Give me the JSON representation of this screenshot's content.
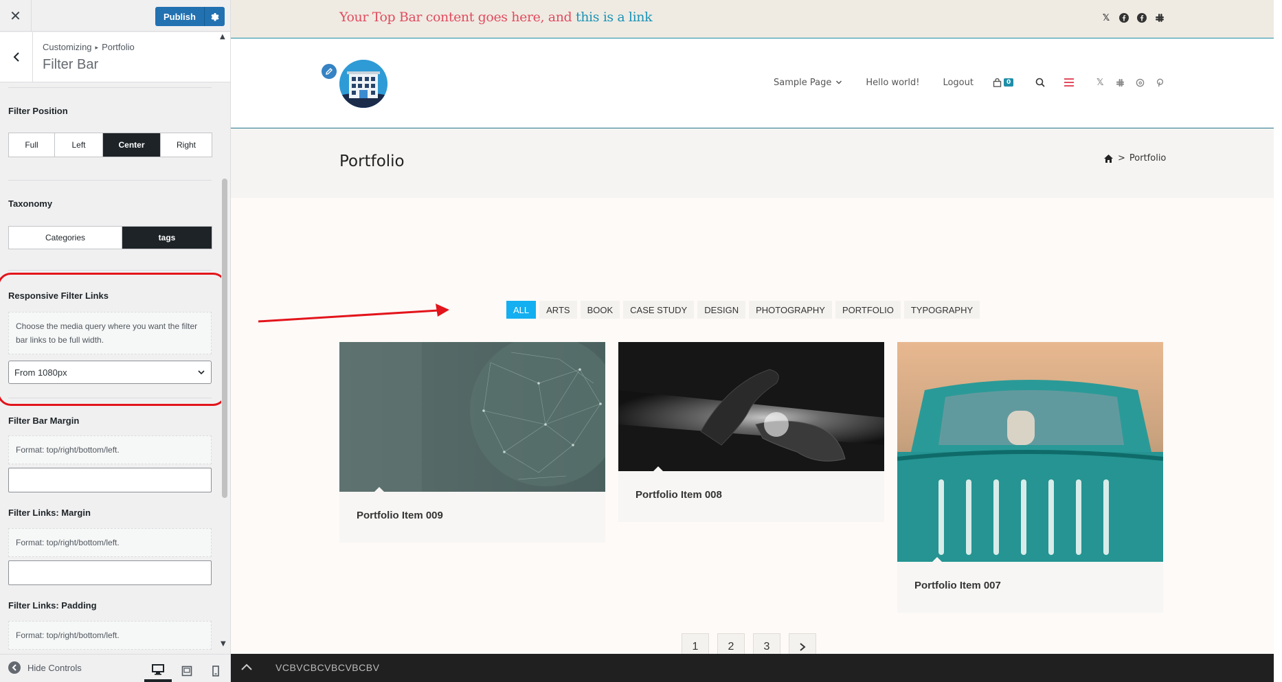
{
  "customizer": {
    "close_icon": "close-icon",
    "publish_label": "Publish",
    "breadcrumb": {
      "root": "Customizing",
      "separator": "▸",
      "parent": "Portfolio"
    },
    "section_title": "Filter Bar",
    "filter_position": {
      "label": "Filter Position",
      "options": [
        "Full",
        "Left",
        "Center",
        "Right"
      ],
      "selected": "Center"
    },
    "taxonomy": {
      "label": "Taxonomy",
      "options": [
        "Categories",
        "tags"
      ],
      "selected": "tags"
    },
    "responsive_filter_links": {
      "label": "Responsive Filter Links",
      "description": "Choose the media query where you want the filter bar links to be full width.",
      "selected_value": "From 1080px"
    },
    "filter_bar_margin": {
      "label": "Filter Bar Margin",
      "description": "Format: top/right/bottom/left.",
      "value": ""
    },
    "filter_links_margin": {
      "label": "Filter Links: Margin",
      "description": "Format: top/right/bottom/left.",
      "value": ""
    },
    "filter_links_padding": {
      "label": "Filter Links: Padding",
      "description": "Format: top/right/bottom/left."
    },
    "footer": {
      "hide_controls_label": "Hide Controls",
      "selected_device": "desktop"
    },
    "colors": {
      "primary": "#2271b1",
      "highlight": "#e3141b"
    }
  },
  "preview": {
    "topbar": {
      "text": "Your Top Bar content goes here, and ",
      "link_text": "this is a link",
      "social_icons": [
        "x-icon",
        "facebook-icon",
        "facebook-icon",
        "slack-icon"
      ]
    },
    "nav": {
      "items": [
        "Sample Page",
        "Hello world!",
        "Logout"
      ],
      "cart_count": "0",
      "social_icons": [
        "x-icon",
        "slack-icon",
        "threads-icon",
        "pinterest-icon"
      ]
    },
    "page_title": "Portfolio",
    "breadcrumb_current": "Portfolio",
    "filters": [
      "ALL",
      "ARTS",
      "BOOK",
      "CASE STUDY",
      "DESIGN",
      "PHOTOGRAPHY",
      "PORTFOLIO",
      "TYPOGRAPHY"
    ],
    "active_filter": "ALL",
    "items": [
      {
        "title": "Portfolio Item 009"
      },
      {
        "title": "Portfolio Item 008"
      },
      {
        "title": "Portfolio Item 007"
      }
    ],
    "pagination": [
      "1",
      "2",
      "3"
    ],
    "bottom_bar_text": "VCBVCBCVBCVBCBV",
    "colors": {
      "accent": "#13aff0",
      "topbar_text": "#e24b5e",
      "topbar_link": "#1a93b5"
    }
  }
}
